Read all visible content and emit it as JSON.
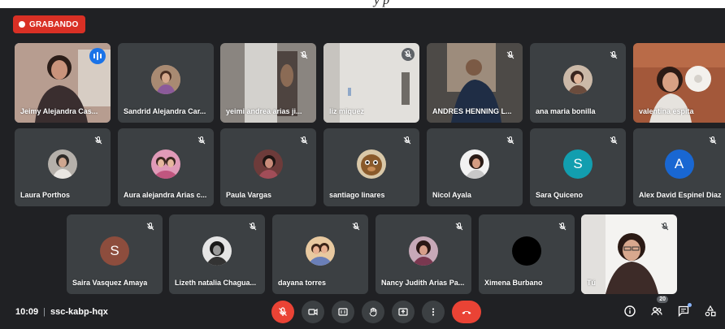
{
  "top_fragment": "y p",
  "recording": {
    "label": "GRABANDO"
  },
  "row1": [
    {
      "name": "Jeimy Alejandra Cas..."
    },
    {
      "name": "Sandrid Alejandra Car..."
    },
    {
      "name": "yeimi andrea arias ji..."
    },
    {
      "name": "liz miquez"
    },
    {
      "name": "ANDRES HENNING L..."
    },
    {
      "name": "ana maria bonilla"
    },
    {
      "name": "valentina espita"
    }
  ],
  "row2": [
    {
      "name": "Laura Porthos"
    },
    {
      "name": "Aura alejandra Arias c..."
    },
    {
      "name": "Paula Vargas"
    },
    {
      "name": "santiago linares"
    },
    {
      "name": "Nicol Ayala"
    },
    {
      "name": "Sara Quiceno",
      "initial": "S",
      "color": "#129eaf"
    },
    {
      "name": "Alex David Espinel Diaz",
      "initial": "A",
      "color": "#1967d2"
    }
  ],
  "row3": [
    {
      "name": "Saira Vasquez Amaya",
      "initial": "S",
      "color": "#8d4d3d"
    },
    {
      "name": "Lizeth natalia Chagua..."
    },
    {
      "name": "dayana torres"
    },
    {
      "name": "Nancy Judith Arias Pa..."
    },
    {
      "name": "Ximena Burbano"
    },
    {
      "name": "Tú"
    }
  ],
  "footer": {
    "time": "10:09",
    "separator": "|",
    "meeting_code": "ssc-kabp-hqx",
    "participants_count": "20"
  },
  "colors": {
    "stage": "#202124",
    "tile": "#3c4043",
    "danger": "#ea4335",
    "accent": "#8ab4f8"
  }
}
